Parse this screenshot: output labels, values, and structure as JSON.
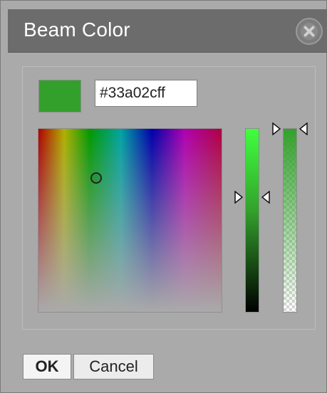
{
  "dialog": {
    "title": "Beam Color",
    "close_icon": "close-icon"
  },
  "picker": {
    "hex_value": "#33a02cff",
    "current_color": "#33a02c",
    "alpha": 1.0
  },
  "buttons": {
    "ok_label": "OK",
    "cancel_label": "Cancel"
  },
  "colors": {
    "titlebar_bg": "#6c6c6c",
    "dialog_bg": "#aaaaaa",
    "selected_color": "#33a02c"
  }
}
